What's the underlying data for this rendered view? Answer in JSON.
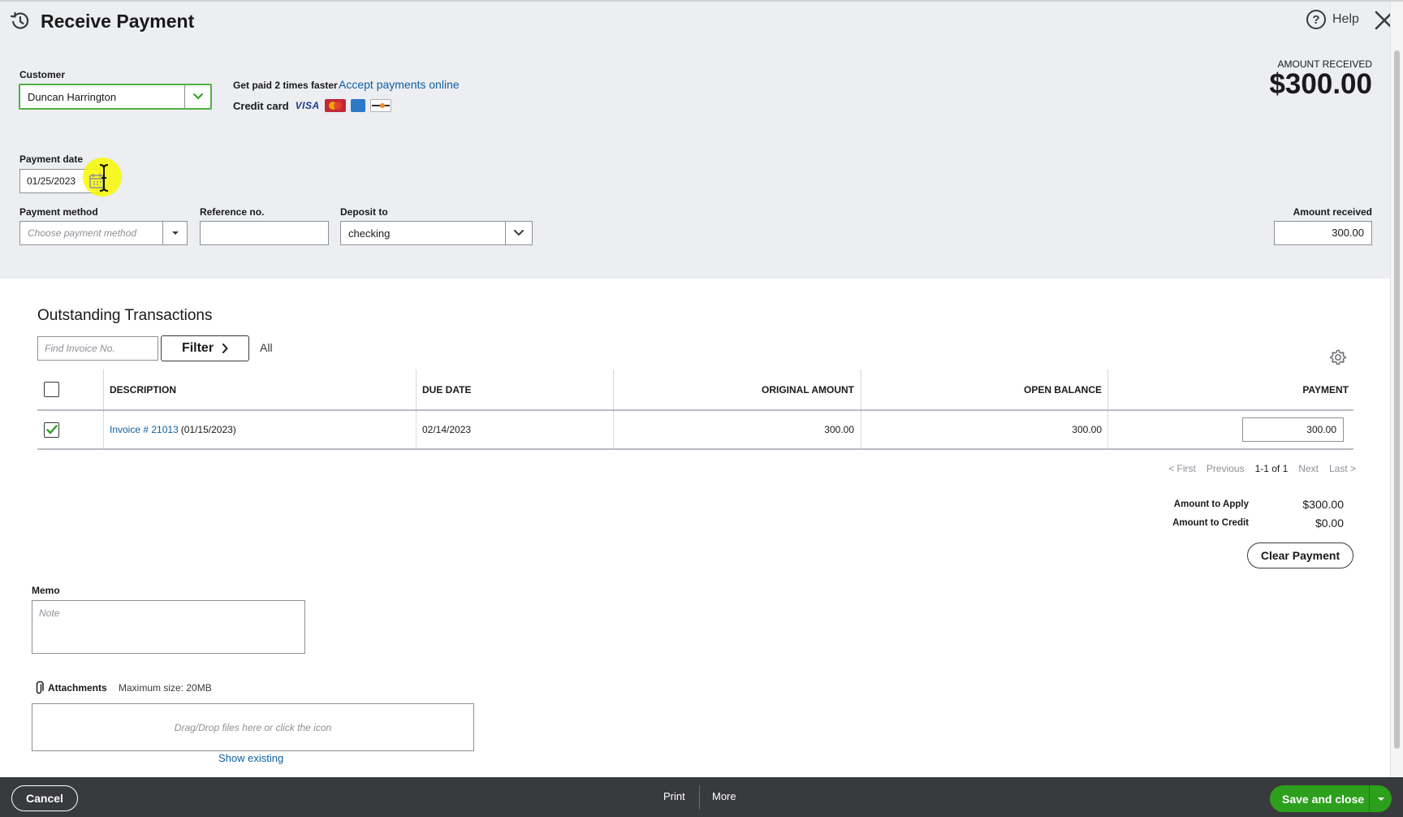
{
  "header": {
    "title": "Receive Payment",
    "help_label": "Help",
    "icons": {
      "history": "history-icon",
      "help": "help-icon",
      "close": "close-icon"
    }
  },
  "customer": {
    "label": "Customer",
    "value": "Duncan Harrington"
  },
  "promo": {
    "get_paid": "Get paid 2 times faster",
    "accept_link": "Accept payments online",
    "credit_card": "Credit card",
    "cards": [
      "VISA",
      "mastercard",
      "amex",
      "discover"
    ]
  },
  "amount_received_summary": {
    "label": "AMOUNT RECEIVED",
    "value": "$300.00"
  },
  "payment_date": {
    "label": "Payment date",
    "value": "01/25/2023"
  },
  "payment_method": {
    "label": "Payment method",
    "placeholder": "Choose payment method"
  },
  "reference": {
    "label": "Reference no.",
    "value": ""
  },
  "deposit_to": {
    "label": "Deposit to",
    "value": "checking"
  },
  "amount_received": {
    "label": "Amount received",
    "value": "300.00"
  },
  "outstanding": {
    "title": "Outstanding Transactions",
    "find_placeholder": "Find Invoice No.",
    "filter_label": "Filter",
    "all_label": "All",
    "columns": [
      "DESCRIPTION",
      "DUE DATE",
      "ORIGINAL AMOUNT",
      "OPEN BALANCE",
      "PAYMENT"
    ],
    "rows": [
      {
        "checked": true,
        "invoice_link": "Invoice # 21013",
        "invoice_date": "(01/15/2023)",
        "due_date": "02/14/2023",
        "original_amount": "300.00",
        "open_balance": "300.00",
        "payment": "300.00"
      }
    ],
    "pagination": {
      "first": "< First",
      "previous": "Previous",
      "range": "1-1 of 1",
      "next": "Next",
      "last": "Last >"
    }
  },
  "totals": {
    "apply_label": "Amount to Apply",
    "apply_value": "$300.00",
    "credit_label": "Amount to Credit",
    "credit_value": "$0.00",
    "clear_button": "Clear Payment"
  },
  "memo": {
    "label": "Memo",
    "placeholder": "Note"
  },
  "attachments": {
    "label": "Attachments",
    "max_size": "Maximum size: 20MB",
    "drop_text": "Drag/Drop files here or click the icon",
    "show_existing": "Show existing"
  },
  "footer": {
    "cancel": "Cancel",
    "print": "Print",
    "more": "More",
    "save": "Save and close"
  },
  "colors": {
    "header_bg": "#eceef1",
    "footer_bg": "#393a3d",
    "primary_green": "#2ca01c",
    "focus_green": "#52b043",
    "link_blue": "#0d5fa3"
  }
}
